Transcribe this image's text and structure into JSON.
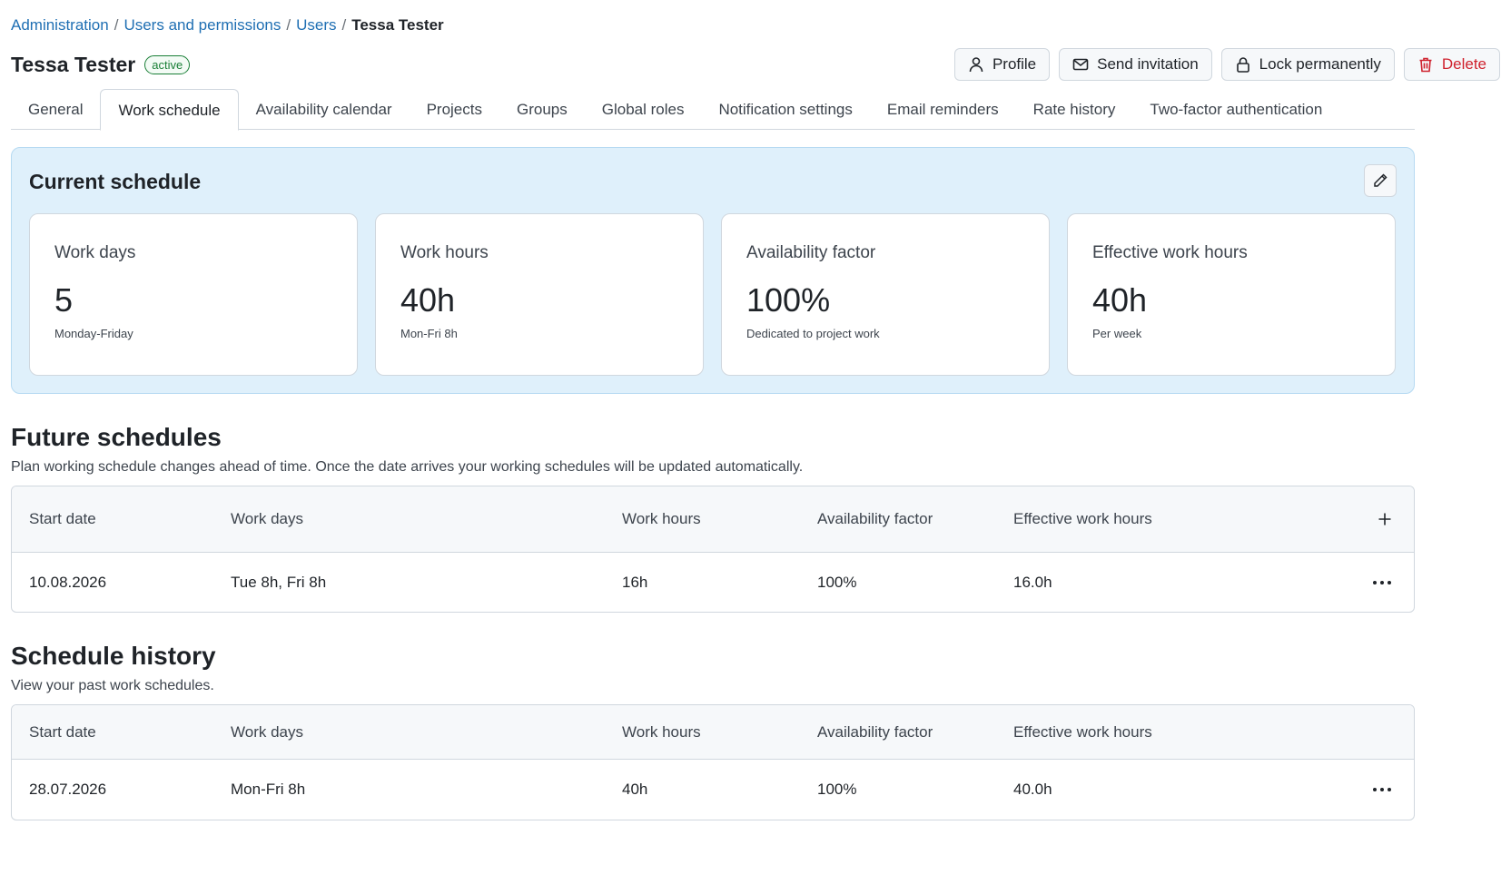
{
  "breadcrumb": {
    "items": [
      "Administration",
      "Users and permissions",
      "Users"
    ],
    "separator": "/",
    "current": "Tessa Tester"
  },
  "user": {
    "name": "Tessa Tester",
    "status": "active"
  },
  "actions": {
    "profile": "Profile",
    "send_invitation": "Send invitation",
    "lock": "Lock permanently",
    "delete": "Delete"
  },
  "tabs": [
    {
      "label": "General"
    },
    {
      "label": "Work schedule",
      "active": true
    },
    {
      "label": "Availability calendar"
    },
    {
      "label": "Projects"
    },
    {
      "label": "Groups"
    },
    {
      "label": "Global roles"
    },
    {
      "label": "Notification settings"
    },
    {
      "label": "Email reminders"
    },
    {
      "label": "Rate history"
    },
    {
      "label": "Two-factor authentication"
    }
  ],
  "current_schedule": {
    "title": "Current schedule",
    "cards": [
      {
        "label": "Work days",
        "value": "5",
        "sub": "Monday-Friday"
      },
      {
        "label": "Work hours",
        "value": "40h",
        "sub": "Mon-Fri 8h"
      },
      {
        "label": "Availability factor",
        "value": "100%",
        "sub": "Dedicated to project work"
      },
      {
        "label": "Effective work hours",
        "value": "40h",
        "sub": "Per week"
      }
    ]
  },
  "columns": {
    "start_date": "Start date",
    "work_days": "Work days",
    "work_hours": "Work hours",
    "availability_factor": "Availability factor",
    "effective_work_hours": "Effective work hours"
  },
  "future": {
    "title": "Future schedules",
    "description": "Plan working schedule changes ahead of time. Once the date arrives your working schedules will be updated automatically.",
    "rows": [
      {
        "start_date": "10.08.2026",
        "work_days": "Tue 8h, Fri 8h",
        "work_hours": "16h",
        "availability_factor": "100%",
        "effective_work_hours": "16.0h"
      }
    ]
  },
  "history": {
    "title": "Schedule history",
    "description": "View your past work schedules.",
    "rows": [
      {
        "start_date": "28.07.2026",
        "work_days": "Mon-Fri 8h",
        "work_hours": "40h",
        "availability_factor": "100%",
        "effective_work_hours": "40.0h"
      }
    ]
  },
  "colors": {
    "link": "#1f6fb3",
    "success": "#1a7f37",
    "danger": "#cf222e",
    "panel_bg": "#dff0fb"
  },
  "icons": {
    "profile": "user-icon",
    "invite": "envelope-icon",
    "lock": "lock-icon",
    "delete": "trash-icon",
    "edit": "pencil-icon",
    "add": "plus-icon",
    "row_menu": "more-horizontal-icon"
  }
}
